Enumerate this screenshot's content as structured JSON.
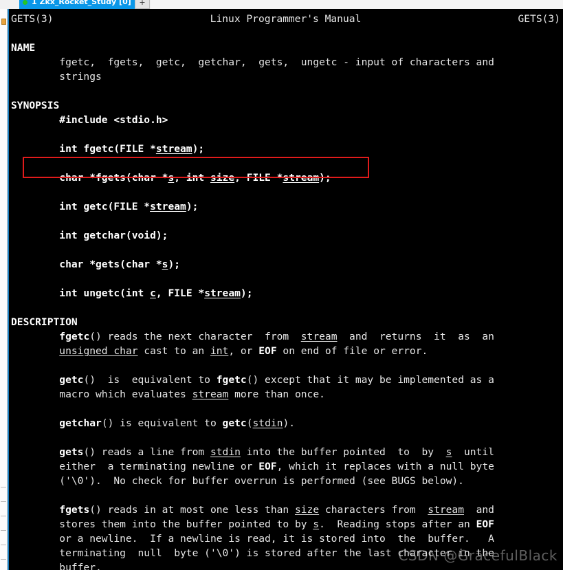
{
  "window": {
    "tab": {
      "title": "1 Zkx_Rocket_Study [0]",
      "status_dot": "connected-dot",
      "new_tab_label": "+"
    }
  },
  "colors": {
    "terminal_bg": "#000000",
    "terminal_fg": "#e6e6e6",
    "tab_active": "#0a97e8",
    "highlight_box": "#e01b1b",
    "gutter_bg": "#fbfbfb",
    "left_border": "#1b7fbf"
  },
  "manpage": {
    "header": {
      "left": "GETS(3)",
      "center": "Linux Programmer's Manual",
      "right": "GETS(3)"
    },
    "sections": [
      {
        "name": "NAME",
        "title": "NAME",
        "lines": [
          "        fgetc,  fgets,  getc,  getchar,  gets,  ungetc - input of characters and",
          "        strings"
        ]
      },
      {
        "name": "SYNOPSIS",
        "title": "SYNOPSIS",
        "lines": [
          "        #include <stdio.h>",
          "",
          "        int fgetc(FILE *stream);",
          "",
          "        char *fgets(char *s, int size, FILE *stream);",
          "",
          "        int getc(FILE *stream);",
          "",
          "        int getchar(void);",
          "",
          "        char *gets(char *s);",
          "",
          "        int ungetc(int c, FILE *stream);"
        ]
      },
      {
        "name": "DESCRIPTION",
        "title": "DESCRIPTION",
        "paragraphs": [
          [
            "        fgetc() reads the next character  from  stream  and  returns  it  as  an",
            "        unsigned char cast to an int, or EOF on end of file or error."
          ],
          [
            "        getc()  is  equivalent to fgetc() except that it may be implemented as a",
            "        macro which evaluates stream more than once."
          ],
          [
            "        getchar() is equivalent to getc(stdin)."
          ],
          [
            "        gets() reads a line from stdin into the buffer pointed  to  by  s  until",
            "        either  a terminating newline or EOF, which it replaces with a null byte",
            "        ('\\0').  No check for buffer overrun is performed (see BUGS below)."
          ],
          [
            "        fgets() reads in at most one less than size characters from  stream  and",
            "        stores them into the buffer pointed to by s.  Reading stops after an EOF",
            "        or a newline.  If a newline is read, it is stored into  the  buffer.   A",
            "        terminating  null  byte ('\\0') is stored after the last character in the",
            "        buffer."
          ]
        ]
      }
    ],
    "highlighted_prototype": "char *fgets(char *s, int size, FILE *stream);"
  },
  "watermark": {
    "text": "CSDN @GracefulBlack"
  }
}
